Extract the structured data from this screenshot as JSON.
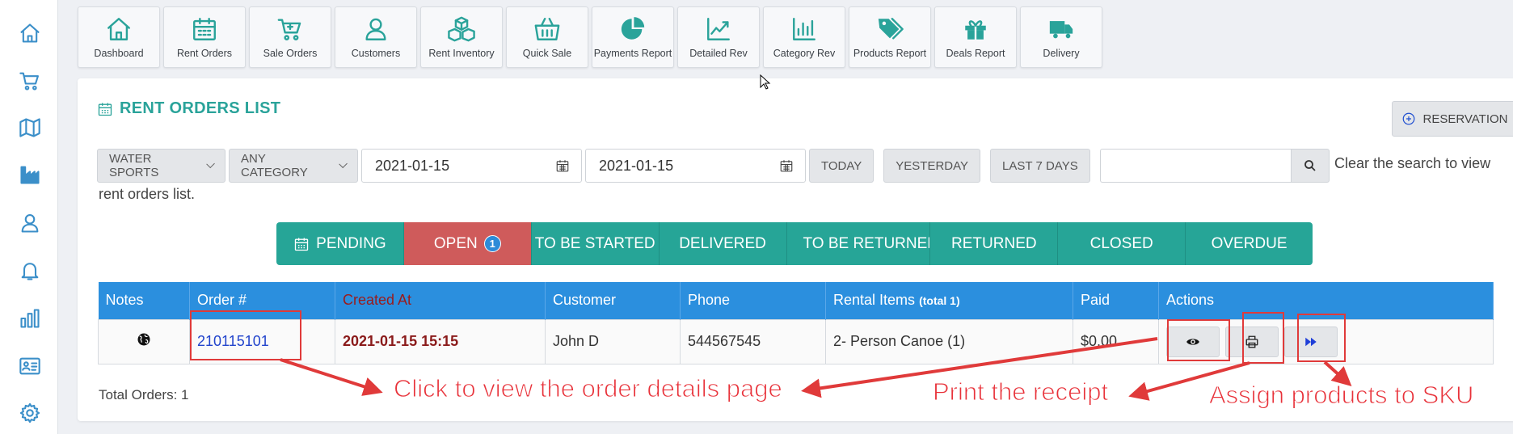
{
  "sidebar": {
    "items": [
      {
        "icon": "home-icon"
      },
      {
        "icon": "cart-icon"
      },
      {
        "icon": "map-icon"
      },
      {
        "icon": "factory-icon"
      },
      {
        "icon": "user-icon"
      },
      {
        "icon": "bell-icon"
      },
      {
        "icon": "bar-chart-icon"
      },
      {
        "icon": "id-card-icon"
      },
      {
        "icon": "gear-icon"
      }
    ]
  },
  "topnav": {
    "items": [
      {
        "label": "Dashboard",
        "icon": "home-icon"
      },
      {
        "label": "Rent Orders",
        "icon": "calendar-icon"
      },
      {
        "label": "Sale Orders",
        "icon": "cart-icon"
      },
      {
        "label": "Customers",
        "icon": "user-icon"
      },
      {
        "label": "Rent Inventory",
        "icon": "cubes-icon"
      },
      {
        "label": "Quick Sale",
        "icon": "basket-icon"
      },
      {
        "label": "Payments Report",
        "icon": "pie-chart-icon"
      },
      {
        "label": "Detailed Rev",
        "icon": "line-chart-icon"
      },
      {
        "label": "Category Rev",
        "icon": "bar-chart-icon"
      },
      {
        "label": "Products Report",
        "icon": "tags-icon"
      },
      {
        "label": "Deals Report",
        "icon": "gift-icon"
      },
      {
        "label": "Delivery",
        "icon": "truck-icon"
      }
    ]
  },
  "page": {
    "title": "RENT ORDERS LIST",
    "reservation_label": "RESERVATION"
  },
  "filters": {
    "category_primary": "WATER SPORTS",
    "category_secondary": "ANY CATEGORY",
    "date_from": "2021-01-15",
    "date_to": "2021-01-15",
    "today": "TODAY",
    "yesterday": "YESTERDAY",
    "last7": "LAST 7 DAYS",
    "search_value": "",
    "hint_line1": "Clear the search to view",
    "hint_line2": "rent orders list."
  },
  "status_tabs": [
    {
      "label": "PENDING",
      "active": false
    },
    {
      "label": "OPEN",
      "active": true,
      "badge": "1"
    },
    {
      "label": "TO BE STARTED",
      "active": false
    },
    {
      "label": "DELIVERED",
      "active": false
    },
    {
      "label": "TO BE RETURNED",
      "active": false
    },
    {
      "label": "RETURNED",
      "active": false
    },
    {
      "label": "CLOSED",
      "active": false
    },
    {
      "label": "OVERDUE",
      "active": false
    }
  ],
  "table": {
    "headers": {
      "notes": "Notes",
      "order": "Order #",
      "created": "Created At",
      "customer": "Customer",
      "phone": "Phone",
      "rental": "Rental Items",
      "rental_total": "(total 1)",
      "paid": "Paid",
      "actions": "Actions"
    },
    "rows": [
      {
        "order": "210115101",
        "created": "2021-01-15 15:15",
        "customer": "John D",
        "phone": "544567545",
        "rental": "2- Person Canoe (1)",
        "paid": "$0.00"
      }
    ]
  },
  "total_orders": "Total Orders: 1",
  "annotations": {
    "view_details": "Click to view the order details page",
    "print_receipt": "Print the receipt",
    "assign_sku": "Assign products to SKU"
  },
  "colors": {
    "teal": "#26a597",
    "active_tab": "#cf5b5b",
    "table_header": "#2b8fde",
    "annotation_red": "#e8323a"
  }
}
